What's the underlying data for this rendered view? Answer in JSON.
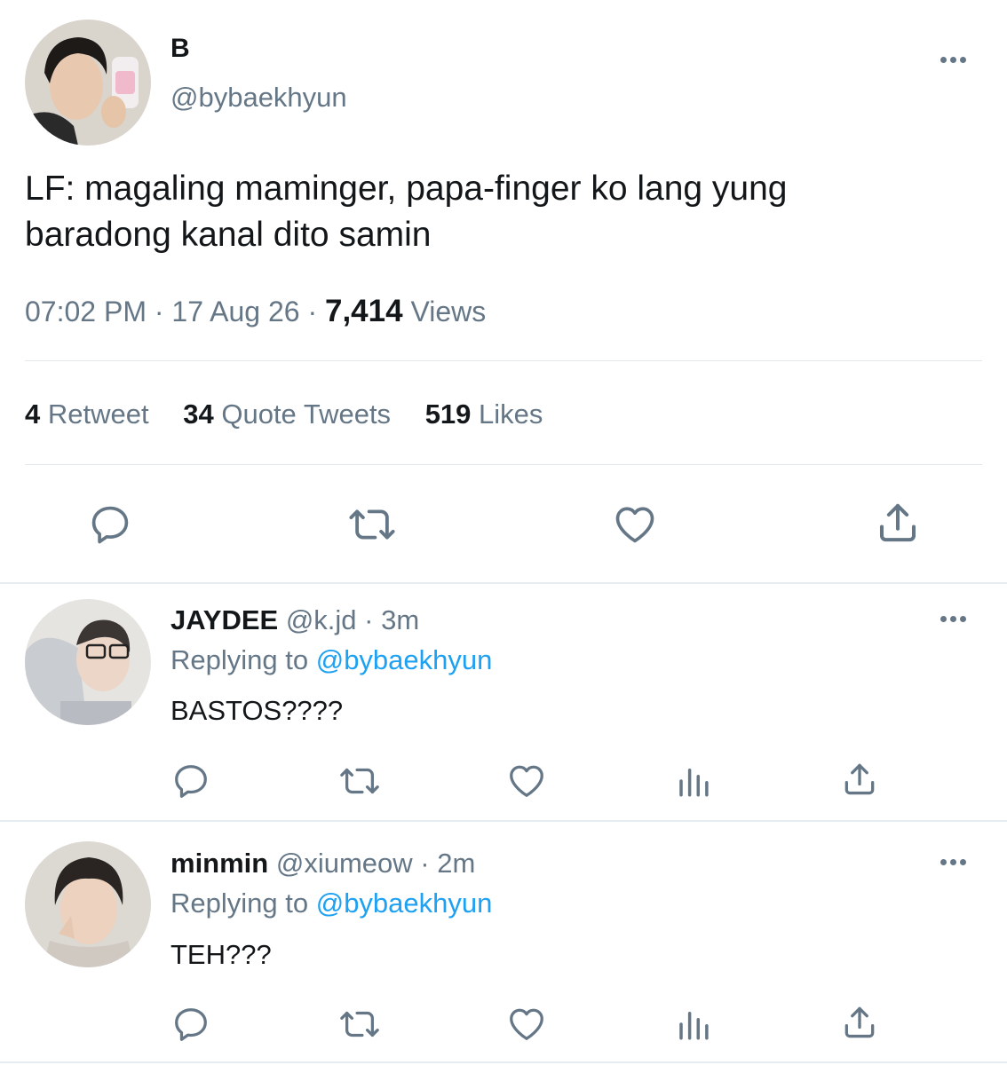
{
  "main_tweet": {
    "display_name": "B",
    "handle": "@bybaekhyun",
    "text_line1": "LF: magaling maminger, papa-finger ko lang yung",
    "text_line2": "baradong kanal dito samin",
    "time": "07:02 PM",
    "date": "17 Aug 26",
    "views_count": "7,414",
    "views_label": "Views",
    "separator": "·",
    "stats": {
      "retweets_count": "4",
      "retweets_label": "Retweet",
      "quotes_count": "34",
      "quotes_label": "Quote Tweets",
      "likes_count": "519",
      "likes_label": "Likes"
    }
  },
  "replies": [
    {
      "display_name": "JAYDEE",
      "handle": "@k.jd",
      "time": "· 3m",
      "replying_prefix": "Replying to",
      "replying_handle": "@bybaekhyun",
      "text": "BASTOS????"
    },
    {
      "display_name": "minmin",
      "handle": "@xiumeow",
      "time": "· 2m",
      "replying_prefix": "Replying to",
      "replying_handle": "@bybaekhyun",
      "text": "TEH???"
    }
  ],
  "icons": {
    "reply": "reply-icon",
    "retweet": "retweet-icon",
    "like": "like-icon",
    "share": "share-icon",
    "analytics": "analytics-icon",
    "more": "more-icon"
  },
  "colors": {
    "text": "#14171a",
    "secondary": "#657786",
    "link": "#1da1f2",
    "divider": "#e1e8ed"
  }
}
